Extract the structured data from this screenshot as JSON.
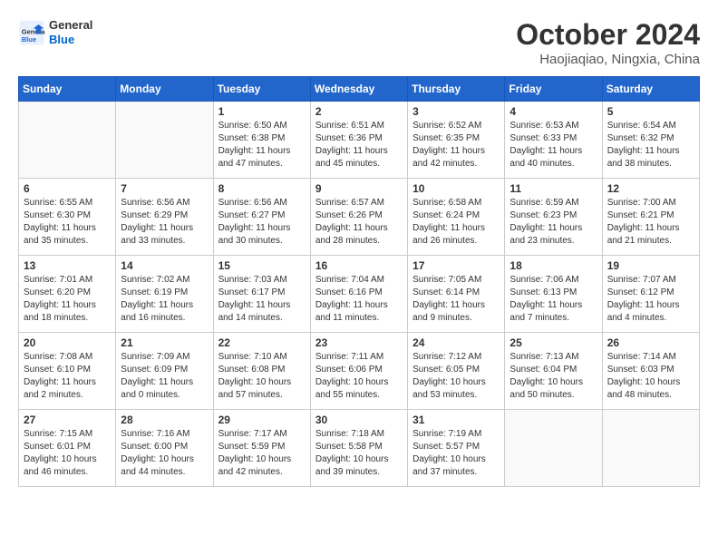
{
  "header": {
    "logo_line1": "General",
    "logo_line2": "Blue",
    "month_title": "October 2024",
    "location": "Haojiaqiao, Ningxia, China"
  },
  "days_of_week": [
    "Sunday",
    "Monday",
    "Tuesday",
    "Wednesday",
    "Thursday",
    "Friday",
    "Saturday"
  ],
  "weeks": [
    [
      {
        "day": "",
        "empty": true
      },
      {
        "day": "",
        "empty": true
      },
      {
        "day": "1",
        "sunrise": "6:50 AM",
        "sunset": "6:38 PM",
        "daylight": "11 hours and 47 minutes."
      },
      {
        "day": "2",
        "sunrise": "6:51 AM",
        "sunset": "6:36 PM",
        "daylight": "11 hours and 45 minutes."
      },
      {
        "day": "3",
        "sunrise": "6:52 AM",
        "sunset": "6:35 PM",
        "daylight": "11 hours and 42 minutes."
      },
      {
        "day": "4",
        "sunrise": "6:53 AM",
        "sunset": "6:33 PM",
        "daylight": "11 hours and 40 minutes."
      },
      {
        "day": "5",
        "sunrise": "6:54 AM",
        "sunset": "6:32 PM",
        "daylight": "11 hours and 38 minutes."
      }
    ],
    [
      {
        "day": "6",
        "sunrise": "6:55 AM",
        "sunset": "6:30 PM",
        "daylight": "11 hours and 35 minutes."
      },
      {
        "day": "7",
        "sunrise": "6:56 AM",
        "sunset": "6:29 PM",
        "daylight": "11 hours and 33 minutes."
      },
      {
        "day": "8",
        "sunrise": "6:56 AM",
        "sunset": "6:27 PM",
        "daylight": "11 hours and 30 minutes."
      },
      {
        "day": "9",
        "sunrise": "6:57 AM",
        "sunset": "6:26 PM",
        "daylight": "11 hours and 28 minutes."
      },
      {
        "day": "10",
        "sunrise": "6:58 AM",
        "sunset": "6:24 PM",
        "daylight": "11 hours and 26 minutes."
      },
      {
        "day": "11",
        "sunrise": "6:59 AM",
        "sunset": "6:23 PM",
        "daylight": "11 hours and 23 minutes."
      },
      {
        "day": "12",
        "sunrise": "7:00 AM",
        "sunset": "6:21 PM",
        "daylight": "11 hours and 21 minutes."
      }
    ],
    [
      {
        "day": "13",
        "sunrise": "7:01 AM",
        "sunset": "6:20 PM",
        "daylight": "11 hours and 18 minutes."
      },
      {
        "day": "14",
        "sunrise": "7:02 AM",
        "sunset": "6:19 PM",
        "daylight": "11 hours and 16 minutes."
      },
      {
        "day": "15",
        "sunrise": "7:03 AM",
        "sunset": "6:17 PM",
        "daylight": "11 hours and 14 minutes."
      },
      {
        "day": "16",
        "sunrise": "7:04 AM",
        "sunset": "6:16 PM",
        "daylight": "11 hours and 11 minutes."
      },
      {
        "day": "17",
        "sunrise": "7:05 AM",
        "sunset": "6:14 PM",
        "daylight": "11 hours and 9 minutes."
      },
      {
        "day": "18",
        "sunrise": "7:06 AM",
        "sunset": "6:13 PM",
        "daylight": "11 hours and 7 minutes."
      },
      {
        "day": "19",
        "sunrise": "7:07 AM",
        "sunset": "6:12 PM",
        "daylight": "11 hours and 4 minutes."
      }
    ],
    [
      {
        "day": "20",
        "sunrise": "7:08 AM",
        "sunset": "6:10 PM",
        "daylight": "11 hours and 2 minutes."
      },
      {
        "day": "21",
        "sunrise": "7:09 AM",
        "sunset": "6:09 PM",
        "daylight": "11 hours and 0 minutes."
      },
      {
        "day": "22",
        "sunrise": "7:10 AM",
        "sunset": "6:08 PM",
        "daylight": "10 hours and 57 minutes."
      },
      {
        "day": "23",
        "sunrise": "7:11 AM",
        "sunset": "6:06 PM",
        "daylight": "10 hours and 55 minutes."
      },
      {
        "day": "24",
        "sunrise": "7:12 AM",
        "sunset": "6:05 PM",
        "daylight": "10 hours and 53 minutes."
      },
      {
        "day": "25",
        "sunrise": "7:13 AM",
        "sunset": "6:04 PM",
        "daylight": "10 hours and 50 minutes."
      },
      {
        "day": "26",
        "sunrise": "7:14 AM",
        "sunset": "6:03 PM",
        "daylight": "10 hours and 48 minutes."
      }
    ],
    [
      {
        "day": "27",
        "sunrise": "7:15 AM",
        "sunset": "6:01 PM",
        "daylight": "10 hours and 46 minutes."
      },
      {
        "day": "28",
        "sunrise": "7:16 AM",
        "sunset": "6:00 PM",
        "daylight": "10 hours and 44 minutes."
      },
      {
        "day": "29",
        "sunrise": "7:17 AM",
        "sunset": "5:59 PM",
        "daylight": "10 hours and 42 minutes."
      },
      {
        "day": "30",
        "sunrise": "7:18 AM",
        "sunset": "5:58 PM",
        "daylight": "10 hours and 39 minutes."
      },
      {
        "day": "31",
        "sunrise": "7:19 AM",
        "sunset": "5:57 PM",
        "daylight": "10 hours and 37 minutes."
      },
      {
        "day": "",
        "empty": true
      },
      {
        "day": "",
        "empty": true
      }
    ]
  ],
  "labels": {
    "sunrise": "Sunrise:",
    "sunset": "Sunset:",
    "daylight": "Daylight:"
  }
}
